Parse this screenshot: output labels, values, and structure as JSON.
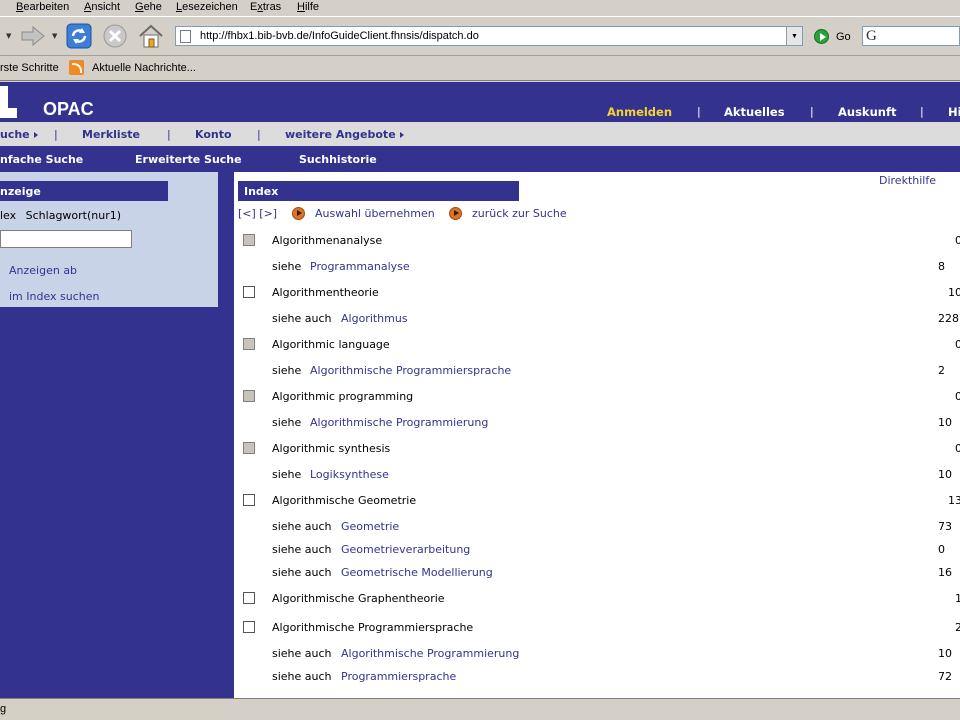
{
  "menubar": {
    "items": [
      {
        "pre": "",
        "key": "B",
        "post": "earbeiten"
      },
      {
        "pre": "",
        "key": "A",
        "post": "nsicht"
      },
      {
        "pre": "",
        "key": "G",
        "post": "ehe"
      },
      {
        "pre": "",
        "key": "L",
        "post": "esezeichen"
      },
      {
        "pre": "E",
        "key": "x",
        "post": "tras"
      },
      {
        "pre": "",
        "key": "H",
        "post": "ilfe"
      }
    ]
  },
  "browser": {
    "url": "http://fhbx1.bib-bvb.de/InfoGuideClient.fhnsis/dispatch.do",
    "go_label": "Go",
    "search_glyph": "G"
  },
  "bookmarks": {
    "first": "rste Schritte",
    "second": "Aktuelle Nachrichte..."
  },
  "header": {
    "title": "OPAC",
    "nav": [
      "Anmelden",
      "Aktuelles",
      "Auskunft",
      "Hi"
    ]
  },
  "subnav1": {
    "items": [
      "uche",
      "Merkliste",
      "Konto",
      "weitere Angebote"
    ]
  },
  "subnav2": {
    "items": [
      "nfache Suche",
      "Erweiterte Suche",
      "Suchhistorie"
    ]
  },
  "left_panel": {
    "heading": "nzeige",
    "index_label": "lex",
    "index_value": "Schlagwort(nur1)",
    "input_value": "",
    "link_show": "Anzeigen ab",
    "link_search": "im Index suchen"
  },
  "content": {
    "help_link": "Direkthilfe",
    "heading": "Index",
    "prev_next": "[<] [>]",
    "apply_label": "Auswahl übernehmen",
    "back_label": "zurück zur Suche"
  },
  "entries": [
    {
      "type": "term",
      "checkbox": "grey",
      "label": "Algorithmenanalyse",
      "count": "0"
    },
    {
      "type": "see",
      "prefix": "siehe",
      "link": "Programmanalyse",
      "count": "8"
    },
    {
      "type": "term",
      "checkbox": "white",
      "label": "Algorithmentheorie",
      "count": "10"
    },
    {
      "type": "see",
      "prefix": "siehe auch",
      "link": "Algorithmus",
      "count": "228"
    },
    {
      "type": "term",
      "checkbox": "grey",
      "label": "Algorithmic language",
      "count": "0"
    },
    {
      "type": "see",
      "prefix": "siehe",
      "link": "Algorithmische Programmiersprache",
      "count": "2"
    },
    {
      "type": "term",
      "checkbox": "grey",
      "label": "Algorithmic programming",
      "count": "0"
    },
    {
      "type": "see",
      "prefix": "siehe",
      "link": "Algorithmische Programmierung",
      "count": "10"
    },
    {
      "type": "term",
      "checkbox": "grey",
      "label": "Algorithmic synthesis",
      "count": "0"
    },
    {
      "type": "see",
      "prefix": "siehe",
      "link": "Logiksynthese",
      "count": "10"
    },
    {
      "type": "term",
      "checkbox": "white",
      "label": "Algorithmische Geometrie",
      "count": "13"
    },
    {
      "type": "see",
      "prefix": "siehe auch",
      "link": "Geometrie",
      "count": "73"
    },
    {
      "type": "see",
      "prefix": "siehe auch",
      "link": "Geometrieverarbeitung",
      "count": "0"
    },
    {
      "type": "see",
      "prefix": "siehe auch",
      "link": "Geometrische Modellierung",
      "count": "16"
    },
    {
      "type": "term",
      "checkbox": "white",
      "label": "Algorithmische Graphentheorie",
      "count": "1"
    },
    {
      "type": "term",
      "checkbox": "white",
      "label": "Algorithmische Programmiersprache",
      "count": "2"
    },
    {
      "type": "see",
      "prefix": "siehe auch",
      "link": "Algorithmische Programmierung",
      "count": "10"
    },
    {
      "type": "see",
      "prefix": "siehe auch",
      "link": "Programmiersprache",
      "count": "72"
    }
  ],
  "status": {
    "text": "g"
  },
  "colors": {
    "brand": "#33338f",
    "active_nav": "#f6d334",
    "panel": "#c9d3e8"
  }
}
